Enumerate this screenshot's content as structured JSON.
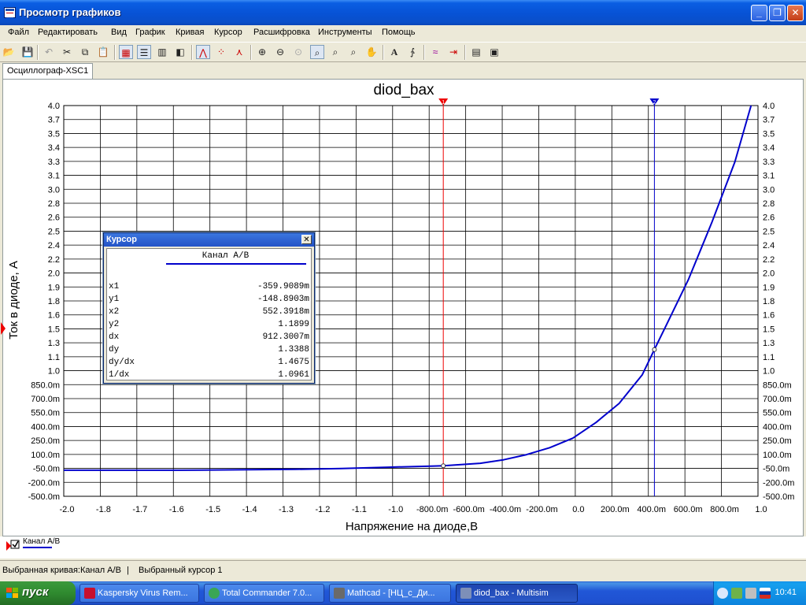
{
  "window": {
    "title": "Просмотр графиков",
    "controls": [
      "minimize",
      "maximize",
      "close"
    ]
  },
  "menu": [
    "Файл",
    "Редактировать",
    "Вид",
    "График",
    "Кривая",
    "Курсор",
    "Расшифровка",
    "Инструменты",
    "Помощь"
  ],
  "toolbar": {
    "icons": [
      "open-icon",
      "save-icon",
      "undo-icon",
      "cut-icon",
      "copy-icon",
      "paste-icon",
      "grid-icon",
      "legend-icon",
      "bar-chart-icon",
      "overlay-icon",
      "cursors-icon",
      "show-points-icon",
      "markers-icon",
      "zoom-in-icon",
      "zoom-out-icon",
      "zoom-fit-icon",
      "zoom-area-icon",
      "zoom-x-icon",
      "zoom-y-icon",
      "pan-icon",
      "text-icon",
      "trace-icon",
      "properties-icon",
      "export-icon",
      "print-icon",
      "print-preview-icon"
    ]
  },
  "tab": {
    "label": "Осциллограф-XSC1"
  },
  "chart_data": {
    "type": "line",
    "title": "diod_bax",
    "xlabel": "Напряжение на диоде,В",
    "ylabel": "Ток в диоде, А",
    "grid": true,
    "x_tick_labels": [
      "-2.0",
      "-1.8",
      "-1.7",
      "-1.6",
      "-1.5",
      "-1.4",
      "-1.3",
      "-1.2",
      "-1.1",
      "-1.0",
      "-800.0m",
      "-600.0m",
      "-400.0m",
      "-200.0m",
      "0.0",
      "200.0m",
      "400.0m",
      "600.0m",
      "800.0m",
      "1.0"
    ],
    "y_tick_labels": [
      "4.0",
      "3.7",
      "3.5",
      "3.4",
      "3.3",
      "3.1",
      "3.0",
      "2.8",
      "2.6",
      "2.5",
      "2.4",
      "2.2",
      "2.0",
      "1.9",
      "1.8",
      "1.6",
      "1.5",
      "1.3",
      "1.1",
      "1.0",
      "850.0m",
      "700.0m",
      "550.0m",
      "400.0m",
      "250.0m",
      "100.0m",
      "-50.0m",
      "-200.0m",
      "-500.0m"
    ],
    "xlim": [
      -2.0,
      1.0
    ],
    "ylim": [
      -0.5,
      4.0
    ],
    "series": [
      {
        "name": "Канал A/B",
        "color": "#0000cc",
        "x": [
          -2.0,
          -1.5,
          -1.0,
          -0.8,
          -0.6,
          -0.4,
          -0.3599,
          -0.2,
          -0.1,
          0.0,
          0.1,
          0.2,
          0.3,
          0.4,
          0.5,
          0.5524,
          0.6,
          0.7,
          0.8,
          0.9,
          0.97
        ],
        "y": [
          -0.2,
          -0.2,
          -0.19,
          -0.18,
          -0.165,
          -0.152,
          -0.1489,
          -0.12,
          -0.08,
          -0.02,
          0.06,
          0.17,
          0.35,
          0.57,
          0.9,
          1.1899,
          1.45,
          2.0,
          2.65,
          3.35,
          4.0
        ]
      }
    ],
    "cursors": [
      {
        "name": "cursor-1",
        "color": "#ee0000",
        "marker": "1",
        "x": -0.3599
      },
      {
        "name": "cursor-2",
        "color": "#0000cc",
        "marker": "2",
        "x": 0.5524
      }
    ],
    "legend": {
      "position": "bottom-left",
      "entries": [
        "Канал A/B"
      ]
    }
  },
  "cursor_panel": {
    "title": "Курсор",
    "channel": "Канал A/B",
    "rows": [
      {
        "key": "x1",
        "value": "-359.9089m"
      },
      {
        "key": "y1",
        "value": "-148.8903m"
      },
      {
        "key": "x2",
        "value": "552.3918m"
      },
      {
        "key": "y2",
        "value": "1.1899"
      },
      {
        "key": "dx",
        "value": "912.3007m"
      },
      {
        "key": "dy",
        "value": "1.3388"
      },
      {
        "key": "dy/dx",
        "value": "1.4675"
      },
      {
        "key": "1/dx",
        "value": "1.0961"
      }
    ]
  },
  "status": {
    "selected_curve": "Выбранная кривая:Канал A/B",
    "divider": "|",
    "selected_cursor": "Выбранный курсор 1"
  },
  "taskbar": {
    "start": "пуск",
    "tasks": [
      {
        "label": "Kaspersky Virus Rem...",
        "color": "#c8102e"
      },
      {
        "label": "Total Commander 7.0...",
        "color": "#3aa655"
      },
      {
        "label": "Mathcad - [НЦ_с_Ди...",
        "color": "#6a6a6a"
      },
      {
        "label": "diod_bax - Multisim",
        "color": "#7d8fb8"
      }
    ],
    "clock": "10:41"
  }
}
